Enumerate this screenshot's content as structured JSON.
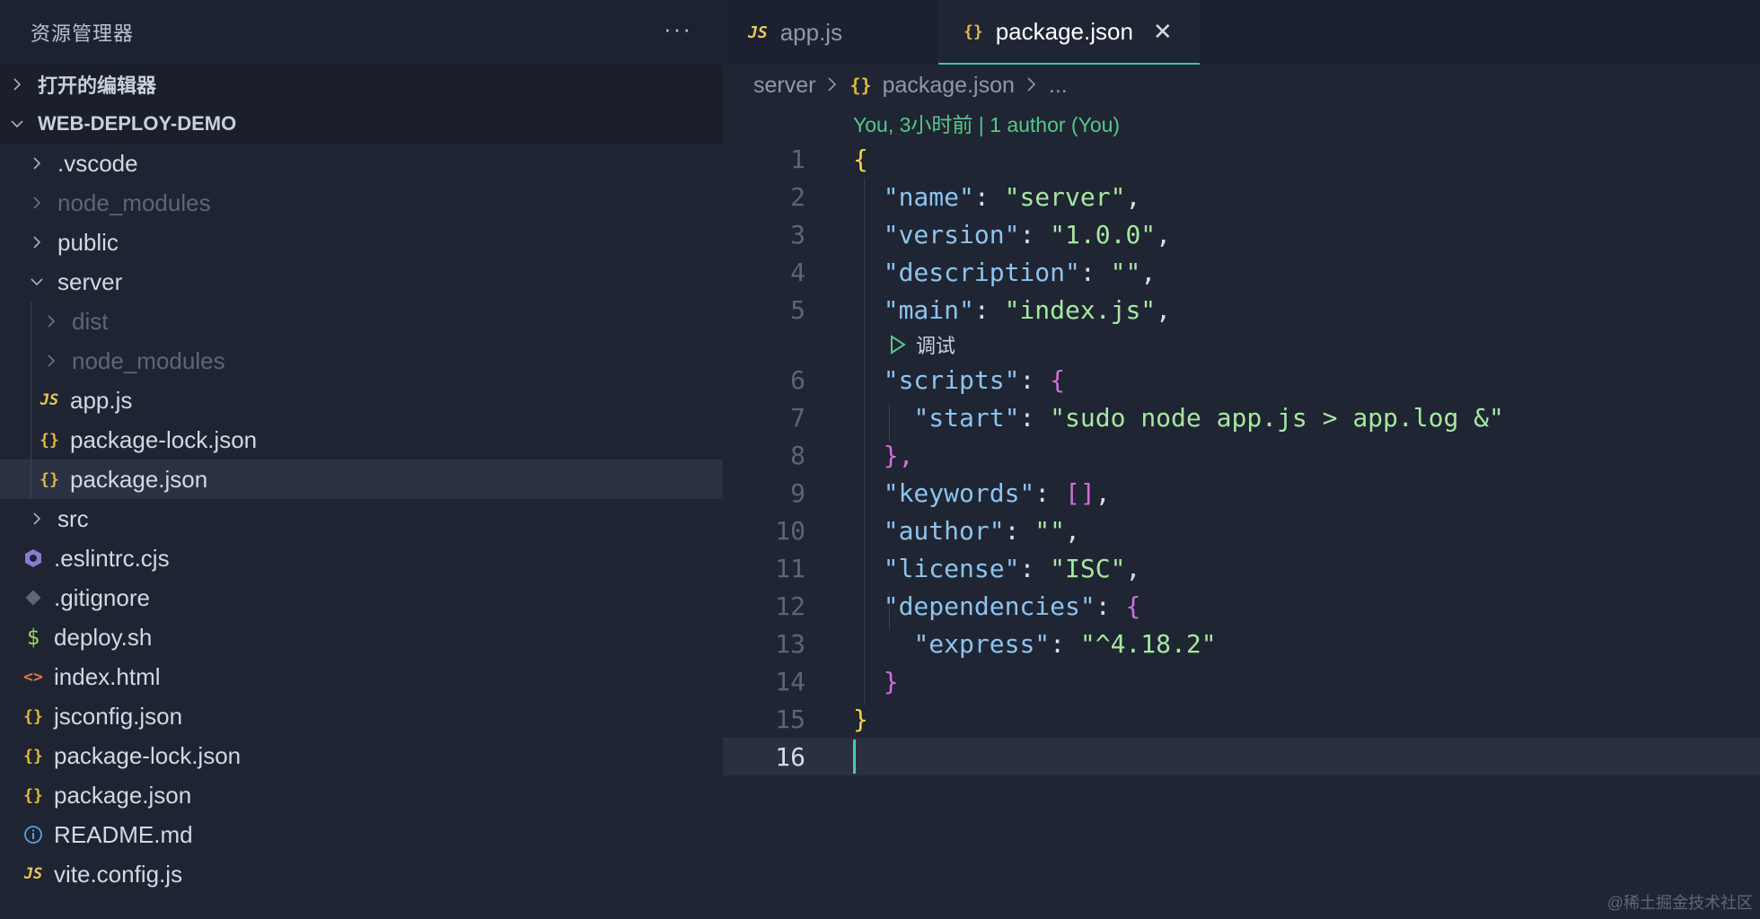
{
  "sidebar": {
    "title": "资源管理器",
    "more": "···",
    "open_editors": "打开的编辑器",
    "root": "WEB-DEPLOY-DEMO",
    "items": [
      {
        "label": ".vscode"
      },
      {
        "label": "node_modules"
      },
      {
        "label": "public"
      },
      {
        "label": "server"
      },
      {
        "label": "dist"
      },
      {
        "label": "node_modules"
      },
      {
        "label": "app.js",
        "icon": "JS"
      },
      {
        "label": "package-lock.json",
        "icon": "{}"
      },
      {
        "label": "package.json",
        "icon": "{}"
      },
      {
        "label": "src"
      },
      {
        "label": ".eslintrc.cjs"
      },
      {
        "label": ".gitignore"
      },
      {
        "label": "deploy.sh",
        "icon": "$"
      },
      {
        "label": "index.html",
        "icon": "<>"
      },
      {
        "label": "jsconfig.json",
        "icon": "{}"
      },
      {
        "label": "package-lock.json",
        "icon": "{}"
      },
      {
        "label": "package.json",
        "icon": "{}"
      },
      {
        "label": "README.md"
      },
      {
        "label": "vite.config.js",
        "icon": "JS"
      }
    ]
  },
  "tabs": [
    {
      "label": "app.js",
      "icon": "JS"
    },
    {
      "label": "package.json",
      "icon": "{}",
      "close": "✕"
    }
  ],
  "breadcrumb": {
    "folder": "server",
    "file": "package.json",
    "more": "..."
  },
  "blame": "You, 3小时前 | 1 author (You)",
  "debug_label": "调试",
  "code": {
    "line_numbers": [
      "1",
      "2",
      "3",
      "4",
      "5",
      "6",
      "7",
      "8",
      "9",
      "10",
      "11",
      "12",
      "13",
      "14",
      "15",
      "16"
    ],
    "l1": "{",
    "name_key": "\"name\"",
    "name_val": "\"server\"",
    "version_key": "\"version\"",
    "version_val": "\"1.0.0\"",
    "desc_key": "\"description\"",
    "desc_val": "\"\"",
    "main_key": "\"main\"",
    "main_val": "\"index.js\"",
    "scripts_key": "\"scripts\"",
    "start_key": "\"start\"",
    "start_val": "\"sudo node app.js > app.log &\"",
    "keywords_key": "\"keywords\"",
    "keywords_val": "[]",
    "author_key": "\"author\"",
    "author_val": "\"\"",
    "license_key": "\"license\"",
    "license_val": "\"ISC\"",
    "deps_key": "\"dependencies\"",
    "express_key": "\"express\"",
    "express_val": "\"^4.18.2\"",
    "open_brace": "{",
    "close_brace": "}",
    "close_brace_comma": "},"
  },
  "watermark": "@稀土掘金技术社区",
  "colors": {
    "accent": "#3fc6a3",
    "json_icon": "#e2b93b",
    "js_icon": "#e8c65b",
    "blame": "#59c68a"
  }
}
